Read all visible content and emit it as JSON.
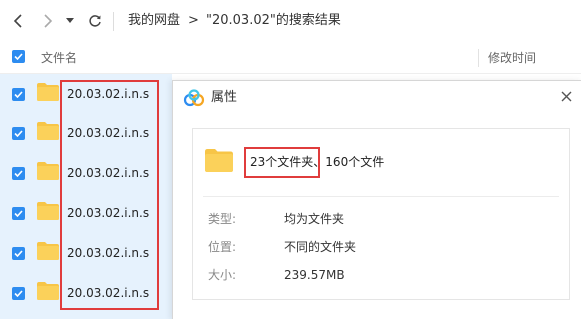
{
  "toolbar": {
    "breadcrumb_root": "我的网盘",
    "breadcrumb_sep": ">",
    "breadcrumb_current": "\"20.03.02\"的搜索结果"
  },
  "columns": {
    "name": "文件名",
    "modified": "修改时间"
  },
  "files": [
    {
      "name": "20.03.02.i.n.s"
    },
    {
      "name": "20.03.02.i.n.s"
    },
    {
      "name": "20.03.02.i.n.s"
    },
    {
      "name": "20.03.02.i.n.s"
    },
    {
      "name": "20.03.02.i.n.s"
    },
    {
      "name": "20.03.02.i.n.s"
    }
  ],
  "dialog": {
    "title": "属性",
    "summary_folders": "23个文件夹",
    "summary_sep": "、",
    "summary_files": "160个文件",
    "properties": [
      {
        "label": "类型:",
        "value": "均为文件夹"
      },
      {
        "label": "位置:",
        "value": "不同的文件夹"
      },
      {
        "label": "大小:",
        "value": "239.57MB"
      }
    ]
  },
  "colors": {
    "accent": "#2d8cf0",
    "folder": "#f7c547",
    "selected_row": "#e6f2fd",
    "annotation": "#e03c3c"
  },
  "icons": [
    "back-icon",
    "forward-icon",
    "dropdown-icon",
    "refresh-icon",
    "checkbox-icon",
    "folder-icon",
    "cloud-logo-icon",
    "close-icon"
  ]
}
